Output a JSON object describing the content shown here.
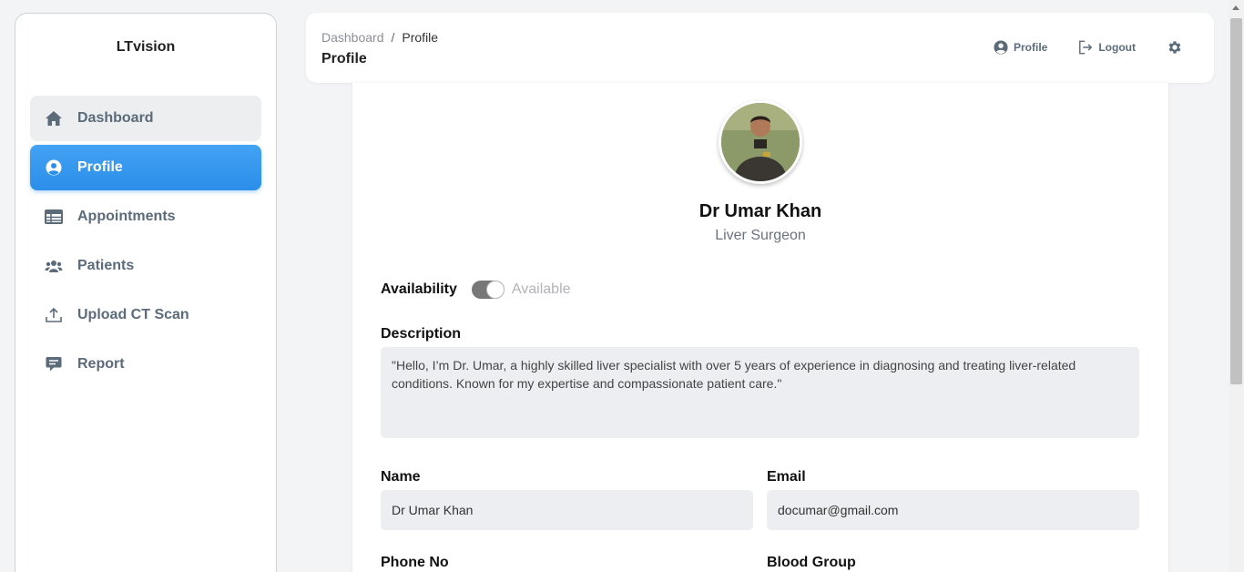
{
  "sidebar": {
    "brand": "LTvision",
    "items": [
      {
        "label": "Dashboard",
        "icon": "home-icon"
      },
      {
        "label": "Profile",
        "icon": "user-circle-icon"
      },
      {
        "label": "Appointments",
        "icon": "table-icon"
      },
      {
        "label": "Patients",
        "icon": "users-icon"
      },
      {
        "label": "Upload CT Scan",
        "icon": "upload-icon"
      },
      {
        "label": "Report",
        "icon": "comment-icon"
      }
    ]
  },
  "header": {
    "breadcrumb_root": "Dashboard",
    "breadcrumb_separator": "/",
    "breadcrumb_current": "Profile",
    "title": "Profile",
    "profile_label": "Profile",
    "logout_label": "Logout"
  },
  "profile": {
    "name": "Dr Umar Khan",
    "specialty": "Liver Surgeon",
    "availability_label": "Availability",
    "availability_status": "Available",
    "availability_on": true,
    "description_label": "Description",
    "description": "\"Hello, I’m Dr. Umar, a highly skilled liver specialist with over 5 years of experience in diagnosing and treating liver-related conditions. Known for my expertise and compassionate patient care.\"",
    "name_label": "Name",
    "name_value": "Dr Umar Khan",
    "email_label": "Email",
    "email_value": "documar@gmail.com",
    "phone_label": "Phone No",
    "blood_label": "Blood Group"
  },
  "colors": {
    "accent": "#2b8ee9",
    "nav_text": "#5b6b7a",
    "field_bg": "#eceef1"
  }
}
